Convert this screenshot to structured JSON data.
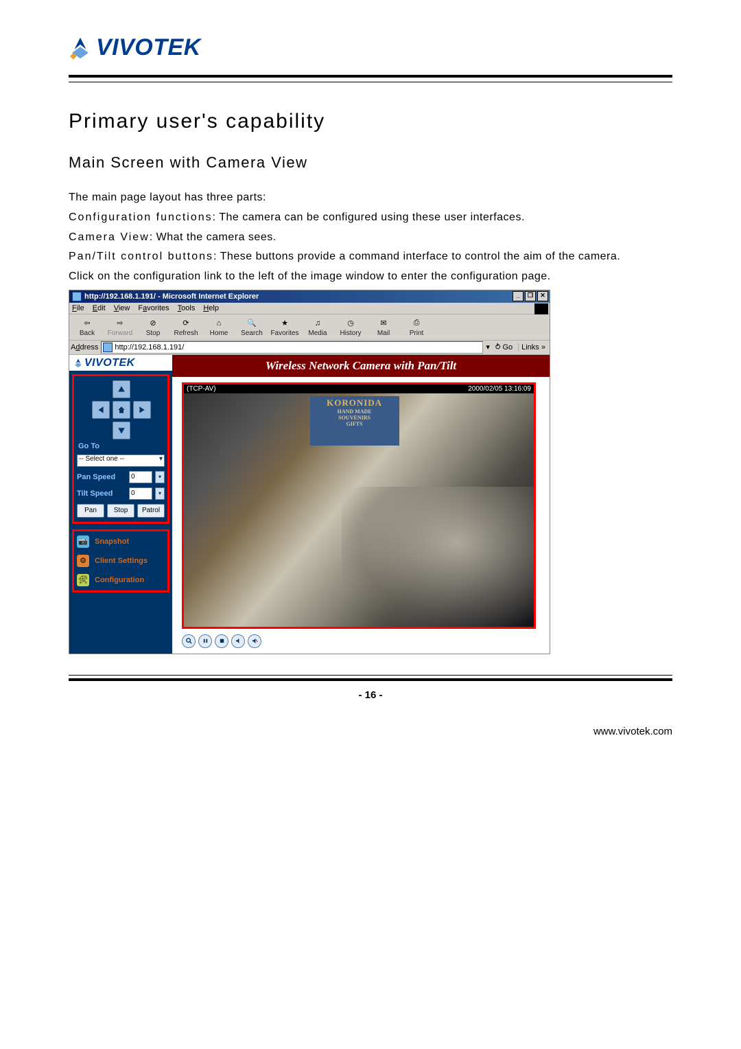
{
  "header": {
    "brand_text": "VIVOTEK"
  },
  "heading1": "Primary user's capability",
  "heading2": "Main Screen with Camera View",
  "paragraphs": {
    "p1": "The main page layout has three parts:",
    "p2a": "Configuration functions",
    "p2b": ": The camera can be configured using these user interfaces.",
    "p3a": "Camera View",
    "p3b": ": What the camera sees.",
    "p4a": "Pan/Tilt control buttons",
    "p4b": ": These buttons provide a command interface to control the aim of the camera.",
    "p5": "Click on the configuration link to the left of the image window to enter the configuration page."
  },
  "browser": {
    "title": "http://192.168.1.191/ - Microsoft Internet Explorer",
    "menus": {
      "file": "File",
      "edit": "Edit",
      "view": "View",
      "fav": "Favorites",
      "tools": "Tools",
      "help": "Help"
    },
    "toolbar": {
      "back": "Back",
      "forward": "Forward",
      "stop": "Stop",
      "refresh": "Refresh",
      "home": "Home",
      "search": "Search",
      "favorites": "Favorites",
      "media": "Media",
      "history": "History",
      "mail": "Mail",
      "print": "Print"
    },
    "address_label": "Address",
    "address_url": "http://192.168.1.191/",
    "go_label": "Go",
    "links_label": "Links",
    "page_title": "Wireless Network Camera with Pan/Tilt",
    "video_proto": "(TCP-AV)",
    "video_time": "2000/02/05 13:16:09",
    "video_sign_line1": "KORONIDA",
    "video_sign_line2": "HAND MADE",
    "video_sign_line3": "SOUVENIRS",
    "video_sign_line4": "GIFTS",
    "sidebar_brand": "VIVOTEK",
    "goto_label": "Go To",
    "goto_placeholder": "-- Select one --",
    "panspeed_label": "Pan Speed",
    "tiltspeed_label": "Tilt Speed",
    "speed_value": "0",
    "btn_pan": "Pan",
    "btn_stop": "Stop",
    "btn_patrol": "Patrol",
    "link_snapshot": "Snapshot",
    "link_client": "Client Settings",
    "link_config": "Configuration"
  },
  "footer": {
    "page_number": "- 16 -",
    "site": "www.vivotek.com"
  }
}
